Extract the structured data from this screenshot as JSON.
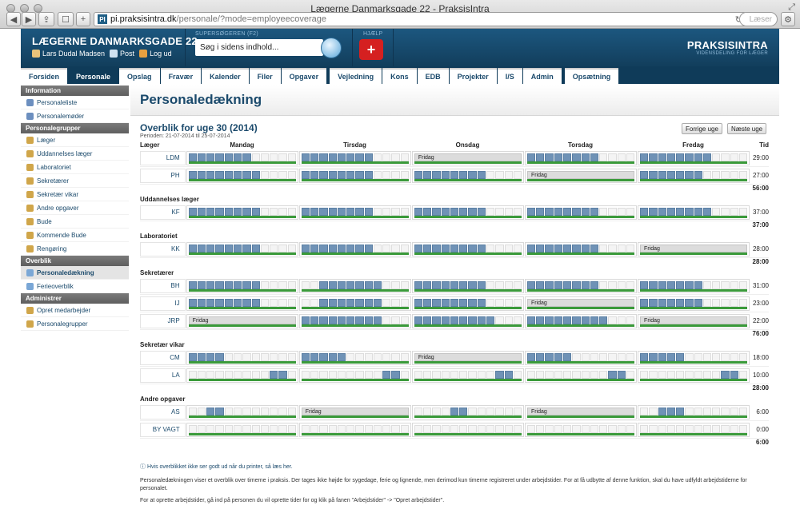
{
  "window": {
    "title": "Lægerne Danmarksgade 22 - PraksisIntra",
    "url_domain": "pi.praksisintra.dk",
    "url_path": "/personale/?mode=employeecoverage",
    "search_placeholder": "Læser"
  },
  "header": {
    "brand": "LÆGERNE DANMARKSGADE 22",
    "user": "Lars Dudal Madsen",
    "post": "Post",
    "logout": "Log ud",
    "search_label": "SUPERSØGEREN (F2)",
    "search_placeholder": "Søg i sidens indhold...",
    "help_label": "HJÆLP",
    "logo": "PRAKSISINTRA",
    "logo_tag": "VIDENSDELING FOR LÆGER"
  },
  "nav": [
    "Forsiden",
    "Personale",
    "Opslag",
    "Fravær",
    "Kalender",
    "Filer",
    "Opgaver",
    "Vejledning",
    "Kons",
    "EDB",
    "Projekter",
    "I/S",
    "Admin",
    "Opsætning"
  ],
  "sidebar": {
    "info": {
      "title": "Information",
      "items": [
        "Personaleliste",
        "Personalemøder"
      ]
    },
    "groups": {
      "title": "Personalegrupper",
      "items": [
        "Læger",
        "Uddannelses læger",
        "Laboratoriet",
        "Sekretærer",
        "Sekretær vikar",
        "Andre opgaver",
        "Bude",
        "Kommende Bude",
        "Rengøring"
      ]
    },
    "overview": {
      "title": "Overblik",
      "items": [
        "Personaledækning",
        "Ferieoverblik"
      ]
    },
    "admin": {
      "title": "Administrer",
      "items": [
        "Opret medarbejder",
        "Personalegrupper"
      ]
    }
  },
  "main": {
    "title": "Personaledækning",
    "week": "Overblik for uge 30 (2014)",
    "period": "Perioden: 21-07-2014 til 25-07-2014",
    "prev": "Forrige uge",
    "next": "Næste uge",
    "days": [
      "Mandag",
      "Tirsdag",
      "Onsdag",
      "Torsdag",
      "Fredag"
    ],
    "col_first": "Læger",
    "col_tid": "Tid",
    "friday_label": "Fridag",
    "groups": [
      {
        "name": "Læger",
        "rows": [
          {
            "init": "LDM",
            "hours": "29:00",
            "days": [
              [
                1,
                1,
                1,
                1,
                1,
                1,
                1,
                0,
                0,
                0,
                0,
                0
              ],
              [
                1,
                1,
                1,
                1,
                1,
                1,
                1,
                1,
                0,
                0,
                0,
                0
              ],
              "F",
              [
                1,
                1,
                1,
                1,
                1,
                1,
                1,
                1,
                0,
                0,
                0,
                0
              ],
              [
                1,
                1,
                1,
                1,
                1,
                1,
                1,
                1,
                0,
                0,
                0,
                0
              ]
            ]
          },
          {
            "init": "PH",
            "hours": "27:00",
            "days": [
              [
                1,
                1,
                1,
                1,
                1,
                1,
                1,
                1,
                0,
                0,
                0,
                0
              ],
              [
                1,
                1,
                1,
                1,
                1,
                1,
                1,
                1,
                0,
                0,
                0,
                0
              ],
              [
                1,
                1,
                1,
                1,
                1,
                1,
                1,
                1,
                0,
                0,
                0,
                0
              ],
              "F",
              [
                1,
                1,
                1,
                1,
                1,
                1,
                1,
                0,
                0,
                0,
                0,
                0
              ]
            ]
          }
        ],
        "total": "56:00"
      },
      {
        "name": "Uddannelses læger",
        "rows": [
          {
            "init": "KF",
            "hours": "37:00",
            "days": [
              [
                1,
                1,
                1,
                1,
                1,
                1,
                1,
                1,
                0,
                0,
                0,
                0
              ],
              [
                1,
                1,
                1,
                1,
                1,
                1,
                1,
                1,
                0,
                0,
                0,
                0
              ],
              [
                1,
                1,
                1,
                1,
                1,
                1,
                1,
                1,
                0,
                0,
                0,
                0
              ],
              [
                1,
                1,
                1,
                1,
                1,
                1,
                1,
                1,
                0,
                0,
                0,
                0
              ],
              [
                1,
                1,
                1,
                1,
                1,
                1,
                1,
                1,
                0,
                0,
                0,
                0
              ]
            ]
          }
        ],
        "total": "37:00"
      },
      {
        "name": "Laboratoriet",
        "rows": [
          {
            "init": "KK",
            "hours": "28:00",
            "days": [
              [
                1,
                1,
                1,
                1,
                1,
                1,
                1,
                1,
                0,
                0,
                0,
                0
              ],
              [
                1,
                1,
                1,
                1,
                1,
                1,
                1,
                1,
                0,
                0,
                0,
                0
              ],
              [
                1,
                1,
                1,
                1,
                1,
                1,
                1,
                1,
                0,
                0,
                0,
                0
              ],
              [
                1,
                1,
                1,
                1,
                1,
                1,
                1,
                1,
                0,
                0,
                0,
                0
              ],
              "F"
            ]
          }
        ],
        "total": "28:00"
      },
      {
        "name": "Sekretærer",
        "rows": [
          {
            "init": "BH",
            "hours": "31:00",
            "days": [
              [
                1,
                1,
                1,
                1,
                1,
                1,
                1,
                1,
                0,
                0,
                0,
                0
              ],
              [
                0,
                0,
                1,
                1,
                1,
                1,
                1,
                1,
                1,
                0,
                0,
                0
              ],
              [
                1,
                1,
                1,
                1,
                1,
                1,
                1,
                1,
                0,
                0,
                0,
                0
              ],
              [
                1,
                1,
                1,
                1,
                1,
                1,
                1,
                1,
                0,
                0,
                0,
                0
              ],
              [
                1,
                1,
                1,
                1,
                1,
                1,
                1,
                0,
                0,
                0,
                0,
                0
              ]
            ]
          },
          {
            "init": "IJ",
            "hours": "23:00",
            "days": [
              [
                1,
                1,
                1,
                1,
                1,
                1,
                1,
                1,
                0,
                0,
                0,
                0
              ],
              [
                0,
                0,
                1,
                1,
                1,
                1,
                1,
                1,
                1,
                0,
                0,
                0
              ],
              [
                1,
                1,
                1,
                1,
                1,
                1,
                1,
                1,
                0,
                0,
                0,
                0
              ],
              "F",
              [
                1,
                1,
                1,
                1,
                1,
                1,
                1,
                0,
                0,
                0,
                0,
                0
              ]
            ]
          },
          {
            "init": "JRP",
            "hours": "22:00",
            "days": [
              "F",
              [
                1,
                1,
                1,
                1,
                1,
                1,
                1,
                1,
                1,
                0,
                0,
                0
              ],
              [
                1,
                1,
                1,
                1,
                1,
                1,
                1,
                1,
                1,
                0,
                0,
                0
              ],
              [
                1,
                1,
                1,
                1,
                1,
                1,
                1,
                1,
                1,
                0,
                0,
                0
              ],
              "F"
            ]
          }
        ],
        "total": "76:00"
      },
      {
        "name": "Sekretær vikar",
        "rows": [
          {
            "init": "CM",
            "hours": "18:00",
            "days": [
              [
                1,
                1,
                1,
                1,
                0,
                0,
                0,
                0,
                0,
                0,
                0,
                0
              ],
              [
                1,
                1,
                1,
                1,
                1,
                0,
                0,
                0,
                0,
                0,
                0,
                0
              ],
              "F",
              [
                1,
                1,
                1,
                1,
                1,
                0,
                0,
                0,
                0,
                0,
                0,
                0
              ],
              [
                1,
                1,
                1,
                1,
                1,
                0,
                0,
                0,
                0,
                0,
                0,
                0
              ]
            ]
          },
          {
            "init": "LA",
            "hours": "10:00",
            "days": [
              [
                0,
                0,
                0,
                0,
                0,
                0,
                0,
                0,
                0,
                1,
                1,
                0
              ],
              [
                0,
                0,
                0,
                0,
                0,
                0,
                0,
                0,
                0,
                1,
                1,
                0
              ],
              [
                0,
                0,
                0,
                0,
                0,
                0,
                0,
                0,
                0,
                1,
                1,
                0
              ],
              [
                0,
                0,
                0,
                0,
                0,
                0,
                0,
                0,
                0,
                1,
                1,
                0
              ],
              [
                0,
                0,
                0,
                0,
                0,
                0,
                0,
                0,
                0,
                1,
                1,
                0
              ]
            ]
          }
        ],
        "total": "28:00"
      },
      {
        "name": "Andre opgaver",
        "rows": [
          {
            "init": "AS",
            "hours": "6:00",
            "days": [
              [
                0,
                0,
                1,
                1,
                0,
                0,
                0,
                0,
                0,
                0,
                0,
                0
              ],
              "F",
              [
                0,
                0,
                0,
                0,
                1,
                1,
                0,
                0,
                0,
                0,
                0,
                0
              ],
              "F",
              [
                0,
                0,
                1,
                1,
                1,
                0,
                0,
                0,
                0,
                0,
                0,
                0
              ]
            ]
          },
          {
            "init": "BY VAGT",
            "hours": "0:00",
            "days": [
              [
                0,
                0,
                0,
                0,
                0,
                0,
                0,
                0,
                0,
                0,
                0,
                0
              ],
              [
                0,
                0,
                0,
                0,
                0,
                0,
                0,
                0,
                0,
                0,
                0,
                0
              ],
              [
                0,
                0,
                0,
                0,
                0,
                0,
                0,
                0,
                0,
                0,
                0,
                0
              ],
              [
                0,
                0,
                0,
                0,
                0,
                0,
                0,
                0,
                0,
                0,
                0,
                0
              ],
              [
                0,
                0,
                0,
                0,
                0,
                0,
                0,
                0,
                0,
                0,
                0,
                0
              ]
            ]
          }
        ],
        "total": "6:00"
      }
    ],
    "note": "Hvis overblikket ikke ser godt ud når du printer, så læs her.",
    "text1": "Personaledækningen viser et overblik over timerne i praksis. Der tages ikke højde for sygedage, ferie og lignende, men derimod kun timerne registreret under arbejdstider. For at få udbytte af denne funktion, skal du have udfyldt arbejdstiderne for personalet.",
    "text2": "For at oprette arbejdstider, gå ind på personen du vil oprette tider for og klik på fanen \"Arbejdstider\" -> \"Opret arbejdstider\"."
  },
  "colors": {
    "header": "#1c577f",
    "nav": "#0f3b59",
    "slot_on": "#6f92b6",
    "green": "#3a9a3a",
    "help": "#d52020"
  }
}
